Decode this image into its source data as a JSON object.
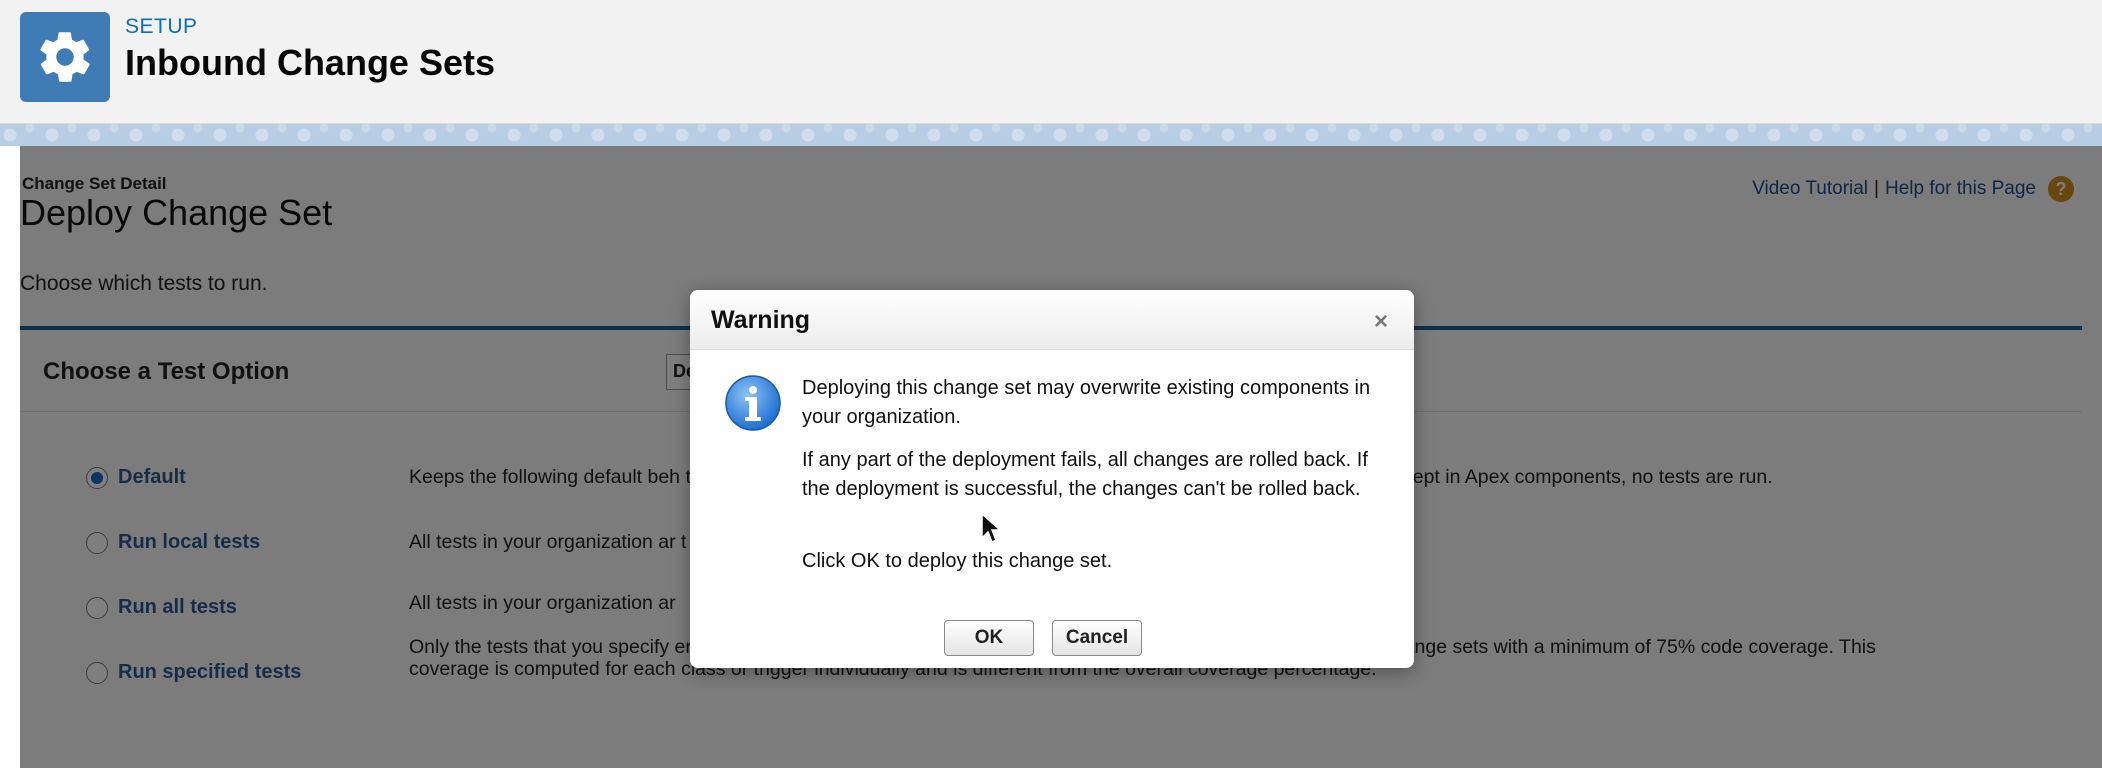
{
  "header": {
    "setup_label": "SETUP",
    "title": "Inbound Change Sets",
    "icon": "gear-icon"
  },
  "content": {
    "detail_label": "Change Set Detail",
    "detail_title": "Deploy Change Set",
    "choose_text": "Choose which tests to run.",
    "help": {
      "video_tutorial": "Video Tutorial",
      "separator": "|",
      "help_page": "Help for this Page",
      "help_icon_glyph": "?"
    },
    "option_section": {
      "title": "Choose a Test Option",
      "dropdown_stub_text": "De"
    },
    "options": [
      {
        "label": "Default",
        "checked": true
      },
      {
        "label": "Run local tests",
        "checked": false
      },
      {
        "label": "Run all tests",
        "checked": false
      },
      {
        "label": "Run specified tests",
        "checked": false
      }
    ],
    "descriptions": [
      "Keeps the following default beh ted if your change sets contain Apex classes or triggers. Local tests are all tests, except in Apex components, no tests are run.",
      "All tests in your organization ar t level is the default for production deployments that include Apex classes or trigger",
      "All tests in your organization ar",
      "Only the tests that you specify erage requirements differ from the default coverage requirements when using this le ange sets with a minimum of 75% code coverage. This coverage is computed for each class or trigger individually and is different from the overall coverage percentage."
    ]
  },
  "dialog": {
    "title": "Warning",
    "close_glyph": "×",
    "message_1": "Deploying this change set may overwrite existing components in your organization.",
    "message_2": "If any part of the deployment fails, all changes are rolled back. If the deployment is successful, the changes can't be rolled back.",
    "message_3": "Click OK to deploy this change set.",
    "ok_label": "OK",
    "cancel_label": "Cancel",
    "icon": "info-icon"
  }
}
